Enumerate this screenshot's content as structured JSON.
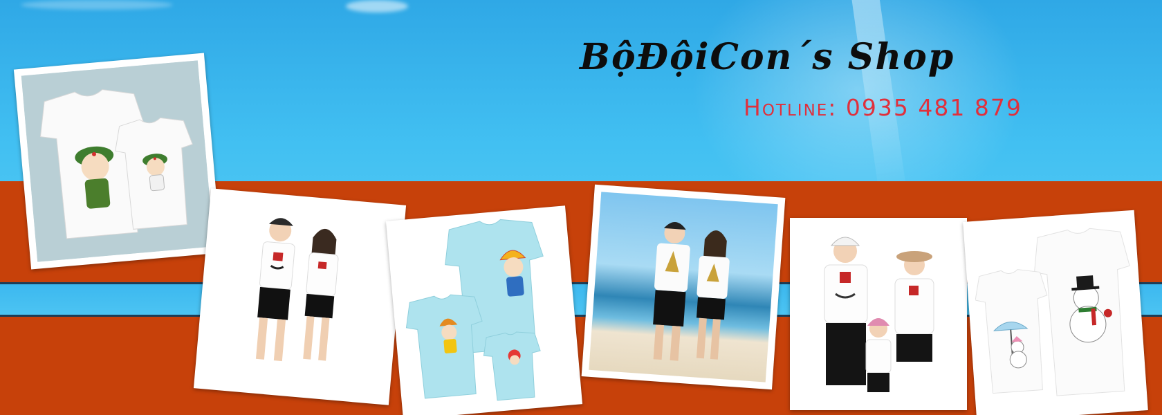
{
  "banner": {
    "shop_name": "BộĐộiCon´s Shop",
    "hotline": "Hotline: 0935 481 879"
  },
  "colors": {
    "sky": "#42c0f2",
    "band_orange": "#c7410a",
    "hotline_red": "#e0303c",
    "title_black": "#0d0d0d"
  },
  "photos": [
    {
      "name": "soldier-kids-tshirts",
      "icon": "tshirt-pair-soldier-cartoon"
    },
    {
      "name": "couple-mustache-hat-tshirts",
      "icon": "couple-photo"
    },
    {
      "name": "family-light-blue-tshirts",
      "icon": "tshirt-trio-beanie-kids"
    },
    {
      "name": "couple-beach-christmas-tree-tshirts",
      "icon": "couple-beach-photo"
    },
    {
      "name": "family-mustache-hat-tshirts",
      "icon": "family-photo"
    },
    {
      "name": "snowman-tshirts",
      "icon": "tshirt-pair-snowman"
    }
  ]
}
